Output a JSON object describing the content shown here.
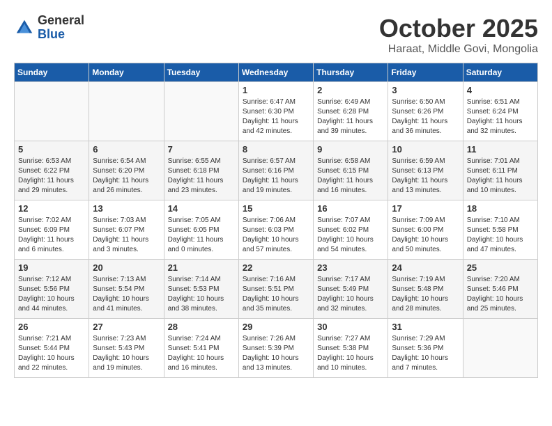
{
  "logo": {
    "general": "General",
    "blue": "Blue"
  },
  "title": "October 2025",
  "location": "Haraat, Middle Govi, Mongolia",
  "days_of_week": [
    "Sunday",
    "Monday",
    "Tuesday",
    "Wednesday",
    "Thursday",
    "Friday",
    "Saturday"
  ],
  "weeks": [
    [
      {
        "day": "",
        "content": ""
      },
      {
        "day": "",
        "content": ""
      },
      {
        "day": "",
        "content": ""
      },
      {
        "day": "1",
        "content": "Sunrise: 6:47 AM\nSunset: 6:30 PM\nDaylight: 11 hours and 42 minutes."
      },
      {
        "day": "2",
        "content": "Sunrise: 6:49 AM\nSunset: 6:28 PM\nDaylight: 11 hours and 39 minutes."
      },
      {
        "day": "3",
        "content": "Sunrise: 6:50 AM\nSunset: 6:26 PM\nDaylight: 11 hours and 36 minutes."
      },
      {
        "day": "4",
        "content": "Sunrise: 6:51 AM\nSunset: 6:24 PM\nDaylight: 11 hours and 32 minutes."
      }
    ],
    [
      {
        "day": "5",
        "content": "Sunrise: 6:53 AM\nSunset: 6:22 PM\nDaylight: 11 hours and 29 minutes."
      },
      {
        "day": "6",
        "content": "Sunrise: 6:54 AM\nSunset: 6:20 PM\nDaylight: 11 hours and 26 minutes."
      },
      {
        "day": "7",
        "content": "Sunrise: 6:55 AM\nSunset: 6:18 PM\nDaylight: 11 hours and 23 minutes."
      },
      {
        "day": "8",
        "content": "Sunrise: 6:57 AM\nSunset: 6:16 PM\nDaylight: 11 hours and 19 minutes."
      },
      {
        "day": "9",
        "content": "Sunrise: 6:58 AM\nSunset: 6:15 PM\nDaylight: 11 hours and 16 minutes."
      },
      {
        "day": "10",
        "content": "Sunrise: 6:59 AM\nSunset: 6:13 PM\nDaylight: 11 hours and 13 minutes."
      },
      {
        "day": "11",
        "content": "Sunrise: 7:01 AM\nSunset: 6:11 PM\nDaylight: 11 hours and 10 minutes."
      }
    ],
    [
      {
        "day": "12",
        "content": "Sunrise: 7:02 AM\nSunset: 6:09 PM\nDaylight: 11 hours and 6 minutes."
      },
      {
        "day": "13",
        "content": "Sunrise: 7:03 AM\nSunset: 6:07 PM\nDaylight: 11 hours and 3 minutes."
      },
      {
        "day": "14",
        "content": "Sunrise: 7:05 AM\nSunset: 6:05 PM\nDaylight: 11 hours and 0 minutes."
      },
      {
        "day": "15",
        "content": "Sunrise: 7:06 AM\nSunset: 6:03 PM\nDaylight: 10 hours and 57 minutes."
      },
      {
        "day": "16",
        "content": "Sunrise: 7:07 AM\nSunset: 6:02 PM\nDaylight: 10 hours and 54 minutes."
      },
      {
        "day": "17",
        "content": "Sunrise: 7:09 AM\nSunset: 6:00 PM\nDaylight: 10 hours and 50 minutes."
      },
      {
        "day": "18",
        "content": "Sunrise: 7:10 AM\nSunset: 5:58 PM\nDaylight: 10 hours and 47 minutes."
      }
    ],
    [
      {
        "day": "19",
        "content": "Sunrise: 7:12 AM\nSunset: 5:56 PM\nDaylight: 10 hours and 44 minutes."
      },
      {
        "day": "20",
        "content": "Sunrise: 7:13 AM\nSunset: 5:54 PM\nDaylight: 10 hours and 41 minutes."
      },
      {
        "day": "21",
        "content": "Sunrise: 7:14 AM\nSunset: 5:53 PM\nDaylight: 10 hours and 38 minutes."
      },
      {
        "day": "22",
        "content": "Sunrise: 7:16 AM\nSunset: 5:51 PM\nDaylight: 10 hours and 35 minutes."
      },
      {
        "day": "23",
        "content": "Sunrise: 7:17 AM\nSunset: 5:49 PM\nDaylight: 10 hours and 32 minutes."
      },
      {
        "day": "24",
        "content": "Sunrise: 7:19 AM\nSunset: 5:48 PM\nDaylight: 10 hours and 28 minutes."
      },
      {
        "day": "25",
        "content": "Sunrise: 7:20 AM\nSunset: 5:46 PM\nDaylight: 10 hours and 25 minutes."
      }
    ],
    [
      {
        "day": "26",
        "content": "Sunrise: 7:21 AM\nSunset: 5:44 PM\nDaylight: 10 hours and 22 minutes."
      },
      {
        "day": "27",
        "content": "Sunrise: 7:23 AM\nSunset: 5:43 PM\nDaylight: 10 hours and 19 minutes."
      },
      {
        "day": "28",
        "content": "Sunrise: 7:24 AM\nSunset: 5:41 PM\nDaylight: 10 hours and 16 minutes."
      },
      {
        "day": "29",
        "content": "Sunrise: 7:26 AM\nSunset: 5:39 PM\nDaylight: 10 hours and 13 minutes."
      },
      {
        "day": "30",
        "content": "Sunrise: 7:27 AM\nSunset: 5:38 PM\nDaylight: 10 hours and 10 minutes."
      },
      {
        "day": "31",
        "content": "Sunrise: 7:29 AM\nSunset: 5:36 PM\nDaylight: 10 hours and 7 minutes."
      },
      {
        "day": "",
        "content": ""
      }
    ]
  ]
}
